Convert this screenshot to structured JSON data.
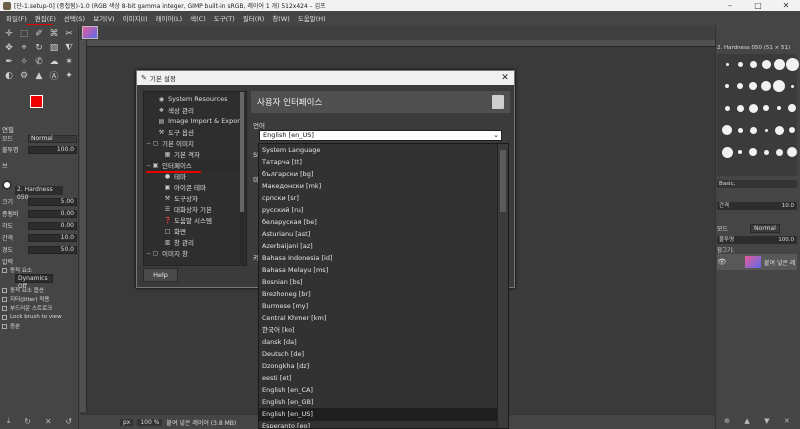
{
  "window": {
    "title": "[단-1.setup-0] (중첩됨)-1.0 (RGB 색상 8-bit gamma integer, GIMP built-in sRGB, 레이어 1 개) 512x424 – 김프",
    "minimize": "–",
    "maximize": "□",
    "close": "✕"
  },
  "menubar": [
    "파일(F)",
    "편집(E)",
    "선택(S)",
    "보기(V)",
    "이미지(I)",
    "레이어(L)",
    "색(C)",
    "도구(T)",
    "필터(R)",
    "창(W)",
    "도움말(H)"
  ],
  "toolbox": {
    "tools": [
      "✛",
      "⬚",
      "✐",
      "⌘",
      "✂",
      "✥",
      "⌖",
      "↻",
      "▨",
      "⧨",
      "✒",
      "✧",
      "✆",
      "☁",
      "✶",
      "◐",
      "⚙",
      "▲",
      "Ⓐ",
      "✦"
    ],
    "mode_label": "모드",
    "mode_value": "Normal",
    "opacity_label": "불투명",
    "opacity_value": "100.0",
    "brush_label": "브",
    "brush_value": "2. Hardness 050",
    "size_label": "크기",
    "size_value": "5.00",
    "aspect_label": "종횡비",
    "aspect_value": "0.00",
    "angle_label": "각도",
    "angle_value": "0.00",
    "spacing_label": "간격",
    "spacing_value": "10.0",
    "hardness_label": "경도",
    "hardness_value": "50.0",
    "force_label": "압력",
    "dynamics_label": "동적 요소",
    "dynamics_value": "Dynamics Off",
    "dyn_options": "동적 요소 옵션",
    "jitter": "지터(Jitter) 적용",
    "smooth": "부드러운 스트로크",
    "lock_brush": "Lock brush to view",
    "incremental": "증분",
    "opts_header": "연필"
  },
  "canvas": {
    "status_unit": "px",
    "status_zoom": "100 %",
    "status_text": "붙여 넣은 레이어 (3.8 MB)"
  },
  "right_panel": {
    "brush_title": "2. Hardness 050 (51 × 51)",
    "brush_preset": "Basic,",
    "spacing_label": "간격",
    "spacing_value": "10.0",
    "layers_mode_label": "모드",
    "layers_mode_value": "Normal",
    "opacity_label": "불투명",
    "opacity_value": "100.0",
    "lock_label": "잠그기:",
    "layer_name": "붙여 넣은 레"
  },
  "dialog": {
    "title": "기본 설정",
    "close": "✕",
    "help": "Help",
    "tree": [
      {
        "label": "System Resources",
        "icon": "◉",
        "level": 1,
        "exp": ""
      },
      {
        "label": "색상 관리",
        "icon": "❖",
        "level": 1,
        "exp": ""
      },
      {
        "label": "Image Import & Export",
        "icon": "▤",
        "level": 1,
        "exp": ""
      },
      {
        "label": "도구 옵션",
        "icon": "⚒",
        "level": 1,
        "exp": ""
      },
      {
        "label": "기본 이미지",
        "icon": "▢",
        "level": 0,
        "exp": "−"
      },
      {
        "label": "기본 격자",
        "icon": "▦",
        "level": 2,
        "exp": ""
      },
      {
        "label": "인터페이스",
        "icon": "▣",
        "level": 0,
        "exp": "−"
      },
      {
        "label": "테마",
        "icon": "●",
        "level": 2,
        "exp": ""
      },
      {
        "label": "아이콘 테마",
        "icon": "▣",
        "level": 2,
        "exp": ""
      },
      {
        "label": "도구상자",
        "icon": "⚒",
        "level": 2,
        "exp": ""
      },
      {
        "label": "대화상자 기본",
        "icon": "☰",
        "level": 2,
        "exp": ""
      },
      {
        "label": "도움말 시스템",
        "icon": "❓",
        "level": 2,
        "exp": ""
      },
      {
        "label": "화면",
        "icon": "□",
        "level": 2,
        "exp": ""
      },
      {
        "label": "창 관리",
        "icon": "▥",
        "level": 2,
        "exp": ""
      },
      {
        "label": "이미지 창",
        "icon": "▢",
        "level": 0,
        "exp": "−"
      }
    ],
    "page_title": "사용자 인터페이스",
    "language_label": "언어",
    "language_value": "English [en_US]",
    "side_st": "St",
    "side_mi": "미",
    "side_ki": "키"
  },
  "language_list": [
    "System Language",
    "Татарча [tt]",
    "български [bg]",
    "Македонски [mk]",
    "српски [sr]",
    "русский [ru]",
    "беларуская [be]",
    "Asturianu [ast]",
    "Azerbaijani [az]",
    "Bahasa Indonesia [id]",
    "Bahasa Melayu [ms]",
    "Bosnian [bs]",
    "Brezhoneg [br]",
    "Burmese [my]",
    "Central Khmer [km]",
    "한국어 [ko]",
    "dansk [da]",
    "Deutsch [de]",
    "Dzongkha [dz]",
    "eesti [et]",
    "English [en_CA]",
    "English [en_GB]",
    "English [en_US]",
    "Esperanto [eo]"
  ],
  "selected_language_index": 22,
  "colors": {
    "foreground": "#ee0000",
    "background": "#ffffff",
    "highlight_red": "#e60000"
  }
}
